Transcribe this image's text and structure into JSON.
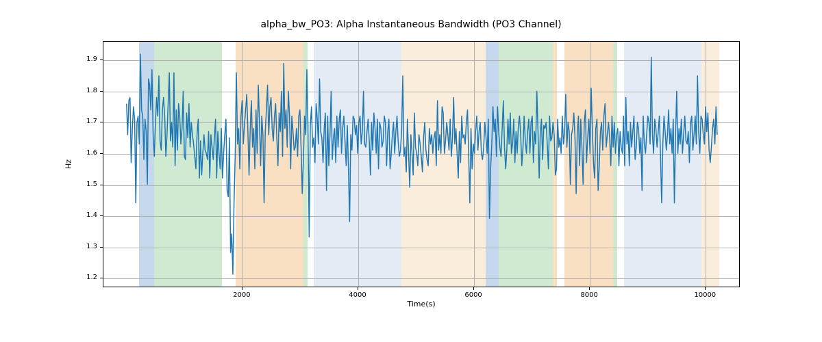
{
  "chart_data": {
    "type": "line",
    "title": "alpha_bw_PO3: Alpha Instantaneous Bandwidth (PO3 Channel)",
    "xlabel": "Time(s)",
    "ylabel": "Hz",
    "xlim": [
      -400,
      10600
    ],
    "ylim": [
      1.17,
      1.96
    ],
    "xticks": [
      2000,
      4000,
      6000,
      8000,
      10000
    ],
    "yticks": [
      1.2,
      1.3,
      1.4,
      1.5,
      1.6,
      1.7,
      1.8,
      1.9
    ],
    "grid": true,
    "line_color": "#1f77b4",
    "bands": [
      {
        "x0": 220,
        "x1": 480,
        "color": "#c3d7eb"
      },
      {
        "x0": 480,
        "x1": 1650,
        "color": "#cde8cf"
      },
      {
        "x0": 1880,
        "x1": 3050,
        "color": "#f9dec0"
      },
      {
        "x0": 3050,
        "x1": 3120,
        "color": "#cde8cf"
      },
      {
        "x0": 3230,
        "x1": 4750,
        "color": "#e2eaf4"
      },
      {
        "x0": 4750,
        "x1": 6200,
        "color": "#fbecd9"
      },
      {
        "x0": 6200,
        "x1": 6420,
        "color": "#c3d7eb"
      },
      {
        "x0": 6420,
        "x1": 7360,
        "color": "#cde8cf"
      },
      {
        "x0": 7360,
        "x1": 7430,
        "color": "#f9dec0"
      },
      {
        "x0": 7560,
        "x1": 8400,
        "color": "#f9dec0"
      },
      {
        "x0": 8400,
        "x1": 8470,
        "color": "#cde8cf"
      },
      {
        "x0": 8590,
        "x1": 9930,
        "color": "#e2eaf4"
      },
      {
        "x0": 9930,
        "x1": 10230,
        "color": "#fbecd9"
      }
    ],
    "x": [
      0,
      20,
      40,
      60,
      80,
      100,
      120,
      140,
      160,
      180,
      200,
      220,
      240,
      260,
      280,
      300,
      320,
      340,
      360,
      380,
      400,
      420,
      440,
      460,
      480,
      500,
      520,
      540,
      560,
      580,
      600,
      620,
      640,
      660,
      680,
      700,
      720,
      740,
      760,
      780,
      800,
      820,
      840,
      860,
      880,
      900,
      920,
      940,
      960,
      980,
      1000,
      1020,
      1040,
      1060,
      1080,
      1100,
      1120,
      1140,
      1160,
      1180,
      1200,
      1220,
      1240,
      1260,
      1280,
      1300,
      1320,
      1340,
      1360,
      1380,
      1400,
      1420,
      1440,
      1460,
      1480,
      1500,
      1520,
      1540,
      1560,
      1580,
      1600,
      1620,
      1640,
      1660,
      1680,
      1700,
      1720,
      1740,
      1760,
      1780,
      1800,
      1820,
      1840,
      1860,
      1880,
      1900,
      1920,
      1940,
      1960,
      1980,
      2000,
      2020,
      2040,
      2060,
      2080,
      2100,
      2120,
      2140,
      2160,
      2180,
      2200,
      2220,
      2240,
      2260,
      2280,
      2300,
      2320,
      2340,
      2360,
      2380,
      2400,
      2420,
      2440,
      2460,
      2480,
      2500,
      2520,
      2540,
      2560,
      2580,
      2600,
      2620,
      2640,
      2660,
      2680,
      2700,
      2720,
      2740,
      2760,
      2780,
      2800,
      2820,
      2840,
      2860,
      2880,
      2900,
      2920,
      2940,
      2960,
      2980,
      3000,
      3020,
      3040,
      3060,
      3080,
      3100,
      3120,
      3140,
      3160,
      3180,
      3200,
      3220,
      3240,
      3260,
      3280,
      3300,
      3320,
      3340,
      3360,
      3380,
      3400,
      3420,
      3440,
      3460,
      3480,
      3500,
      3520,
      3540,
      3560,
      3580,
      3600,
      3620,
      3640,
      3660,
      3680,
      3700,
      3720,
      3740,
      3760,
      3780,
      3800,
      3820,
      3840,
      3860,
      3880,
      3900,
      3920,
      3940,
      3960,
      3980,
      4000,
      4020,
      4040,
      4060,
      4080,
      4100,
      4120,
      4140,
      4160,
      4180,
      4200,
      4220,
      4240,
      4260,
      4280,
      4300,
      4320,
      4340,
      4360,
      4380,
      4400,
      4420,
      4440,
      4460,
      4480,
      4500,
      4520,
      4540,
      4560,
      4580,
      4600,
      4620,
      4640,
      4660,
      4680,
      4700,
      4720,
      4740,
      4760,
      4780,
      4800,
      4820,
      4840,
      4860,
      4880,
      4900,
      4920,
      4940,
      4960,
      4980,
      5000,
      5020,
      5040,
      5060,
      5080,
      5100,
      5120,
      5140,
      5160,
      5180,
      5200,
      5220,
      5240,
      5260,
      5280,
      5300,
      5320,
      5340,
      5360,
      5380,
      5400,
      5420,
      5440,
      5460,
      5480,
      5500,
      5520,
      5540,
      5560,
      5580,
      5600,
      5620,
      5640,
      5660,
      5680,
      5700,
      5720,
      5740,
      5760,
      5780,
      5800,
      5820,
      5840,
      5860,
      5880,
      5900,
      5920,
      5940,
      5960,
      5980,
      6000,
      6020,
      6040,
      6060,
      6080,
      6100,
      6120,
      6140,
      6160,
      6180,
      6200,
      6220,
      6240,
      6260,
      6280,
      6300,
      6320,
      6340,
      6360,
      6380,
      6400,
      6420,
      6440,
      6460,
      6480,
      6500,
      6520,
      6540,
      6560,
      6580,
      6600,
      6620,
      6640,
      6660,
      6680,
      6700,
      6720,
      6740,
      6760,
      6780,
      6800,
      6820,
      6840,
      6860,
      6880,
      6900,
      6920,
      6940,
      6960,
      6980,
      7000,
      7020,
      7040,
      7060,
      7080,
      7100,
      7120,
      7140,
      7160,
      7180,
      7200,
      7220,
      7240,
      7260,
      7280,
      7300,
      7320,
      7340,
      7360,
      7380,
      7400,
      7420,
      7440,
      7460,
      7480,
      7500,
      7520,
      7540,
      7560,
      7580,
      7600,
      7620,
      7640,
      7660,
      7680,
      7700,
      7720,
      7740,
      7760,
      7780,
      7800,
      7820,
      7840,
      7860,
      7880,
      7900,
      7920,
      7940,
      7960,
      7980,
      8000,
      8020,
      8040,
      8060,
      8080,
      8100,
      8120,
      8140,
      8160,
      8180,
      8200,
      8220,
      8240,
      8260,
      8280,
      8300,
      8320,
      8340,
      8360,
      8380,
      8400,
      8420,
      8440,
      8460,
      8480,
      8500,
      8520,
      8540,
      8560,
      8580,
      8600,
      8620,
      8640,
      8660,
      8680,
      8700,
      8720,
      8740,
      8760,
      8780,
      8800,
      8820,
      8840,
      8860,
      8880,
      8900,
      8920,
      8940,
      8960,
      8980,
      9000,
      9020,
      9040,
      9060,
      9080,
      9100,
      9120,
      9140,
      9160,
      9180,
      9200,
      9220,
      9240,
      9260,
      9280,
      9300,
      9320,
      9340,
      9360,
      9380,
      9400,
      9420,
      9440,
      9460,
      9480,
      9500,
      9520,
      9540,
      9560,
      9580,
      9600,
      9620,
      9640,
      9660,
      9680,
      9700,
      9720,
      9740,
      9760,
      9780,
      9800,
      9820,
      9840,
      9860,
      9880,
      9900,
      9920,
      9940,
      9960,
      9980,
      10000,
      10020,
      10040,
      10060,
      10080,
      10100,
      10120,
      10140,
      10160,
      10180,
      10200,
      10220
    ],
    "y": [
      1.76,
      1.66,
      1.77,
      1.78,
      1.57,
      1.68,
      1.75,
      1.71,
      1.44,
      1.7,
      1.72,
      1.63,
      1.92,
      1.74,
      1.72,
      1.58,
      1.71,
      1.67,
      1.5,
      1.84,
      1.82,
      1.74,
      1.87,
      1.66,
      1.59,
      1.7,
      1.78,
      1.72,
      1.85,
      1.64,
      1.61,
      1.74,
      1.78,
      1.72,
      1.59,
      1.66,
      1.76,
      1.86,
      1.64,
      1.7,
      1.62,
      1.86,
      1.56,
      1.74,
      1.61,
      1.76,
      1.72,
      1.63,
      1.68,
      1.8,
      1.59,
      1.58,
      1.73,
      1.65,
      1.76,
      1.62,
      1.7,
      1.66,
      1.63,
      1.59,
      1.55,
      1.66,
      1.71,
      1.52,
      1.64,
      1.53,
      1.6,
      1.66,
      1.61,
      1.6,
      1.58,
      1.67,
      1.52,
      1.66,
      1.62,
      1.58,
      1.65,
      1.71,
      1.52,
      1.67,
      1.6,
      1.55,
      1.68,
      1.52,
      1.6,
      1.66,
      1.71,
      1.48,
      1.46,
      1.65,
      1.28,
      1.34,
      1.21,
      1.44,
      1.59,
      1.86,
      1.63,
      1.68,
      1.55,
      1.72,
      1.77,
      1.63,
      1.69,
      1.74,
      1.79,
      1.67,
      1.53,
      1.68,
      1.77,
      1.62,
      1.68,
      1.55,
      1.74,
      1.6,
      1.82,
      1.7,
      1.56,
      1.72,
      1.66,
      1.44,
      1.67,
      1.74,
      1.82,
      1.66,
      1.75,
      1.78,
      1.68,
      1.64,
      1.72,
      1.76,
      1.65,
      1.56,
      1.73,
      1.67,
      1.8,
      1.59,
      1.89,
      1.68,
      1.74,
      1.62,
      1.8,
      1.72,
      1.55,
      1.72,
      1.67,
      1.61,
      1.62,
      1.68,
      1.59,
      1.72,
      1.74,
      1.62,
      1.47,
      1.58,
      1.72,
      1.66,
      1.87,
      1.68,
      1.33,
      1.69,
      1.75,
      1.62,
      1.65,
      1.57,
      1.76,
      1.71,
      1.63,
      1.84,
      1.67,
      1.65,
      1.57,
      1.68,
      1.73,
      1.48,
      1.72,
      1.56,
      1.66,
      1.8,
      1.58,
      1.65,
      1.68,
      1.57,
      1.72,
      1.62,
      1.71,
      1.74,
      1.6,
      1.68,
      1.72,
      1.64,
      1.56,
      1.69,
      1.55,
      1.38,
      1.66,
      1.61,
      1.72,
      1.71,
      1.66,
      1.69,
      1.6,
      1.7,
      1.72,
      1.63,
      1.67,
      1.8,
      1.63,
      1.62,
      1.67,
      1.71,
      1.64,
      1.53,
      1.7,
      1.61,
      1.73,
      1.68,
      1.6,
      1.71,
      1.55,
      1.7,
      1.68,
      1.62,
      1.64,
      1.72,
      1.7,
      1.56,
      1.67,
      1.71,
      1.55,
      1.6,
      1.66,
      1.7,
      1.6,
      1.67,
      1.72,
      1.64,
      1.59,
      1.61,
      1.67,
      1.85,
      1.59,
      1.62,
      1.54,
      1.71,
      1.6,
      1.49,
      1.66,
      1.6,
      1.53,
      1.73,
      1.62,
      1.6,
      1.56,
      1.66,
      1.63,
      1.59,
      1.54,
      1.65,
      1.7,
      1.61,
      1.58,
      1.56,
      1.68,
      1.63,
      1.66,
      1.6,
      1.65,
      1.67,
      1.56,
      1.77,
      1.61,
      1.66,
      1.6,
      1.75,
      1.73,
      1.6,
      1.64,
      1.7,
      1.66,
      1.61,
      1.71,
      1.59,
      1.65,
      1.78,
      1.63,
      1.68,
      1.6,
      1.52,
      1.67,
      1.57,
      1.72,
      1.65,
      1.66,
      1.63,
      1.7,
      1.74,
      1.6,
      1.44,
      1.68,
      1.55,
      1.63,
      1.6,
      1.67,
      1.72,
      1.61,
      1.67,
      1.7,
      1.6,
      1.58,
      1.62,
      1.7,
      1.65,
      1.6,
      1.71,
      1.39,
      1.55,
      1.63,
      1.75,
      1.67,
      1.71,
      1.59,
      1.75,
      1.67,
      1.62,
      1.59,
      1.68,
      1.77,
      1.62,
      1.55,
      1.61,
      1.71,
      1.63,
      1.73,
      1.6,
      1.63,
      1.71,
      1.57,
      1.67,
      1.6,
      1.69,
      1.72,
      1.66,
      1.56,
      1.62,
      1.72,
      1.64,
      1.6,
      1.67,
      1.71,
      1.6,
      1.7,
      1.72,
      1.57,
      1.67,
      1.63,
      1.8,
      1.67,
      1.52,
      1.67,
      1.71,
      1.58,
      1.69,
      1.68,
      1.7,
      1.63,
      1.55,
      1.72,
      1.64,
      1.65,
      1.7,
      1.66,
      1.53,
      1.55,
      1.71,
      1.62,
      1.65,
      1.6,
      1.72,
      1.63,
      1.67,
      1.79,
      1.62,
      1.7,
      1.67,
      1.5,
      1.66,
      1.68,
      1.73,
      1.65,
      1.47,
      1.67,
      1.72,
      1.56,
      1.71,
      1.62,
      1.5,
      1.7,
      1.74,
      1.57,
      1.65,
      1.71,
      1.6,
      1.81,
      1.68,
      1.57,
      1.52,
      1.68,
      1.71,
      1.48,
      1.56,
      1.67,
      1.7,
      1.61,
      1.72,
      1.76,
      1.62,
      1.66,
      1.7,
      1.65,
      1.56,
      1.72,
      1.62,
      1.7,
      1.6,
      1.66,
      1.68,
      1.56,
      1.67,
      1.62,
      1.6,
      1.72,
      1.56,
      1.78,
      1.63,
      1.67,
      1.56,
      1.7,
      1.62,
      1.67,
      1.72,
      1.58,
      1.62,
      1.7,
      1.68,
      1.6,
      1.65,
      1.48,
      1.72,
      1.63,
      1.6,
      1.66,
      1.72,
      1.7,
      1.63,
      1.91,
      1.66,
      1.6,
      1.71,
      1.68,
      1.62,
      1.67,
      1.72,
      1.59,
      1.44,
      1.63,
      1.72,
      1.67,
      1.61,
      1.66,
      1.74,
      1.63,
      1.68,
      1.6,
      1.71,
      1.44,
      1.66,
      1.8,
      1.6,
      1.68,
      1.63,
      1.71,
      1.6,
      1.66,
      1.72,
      1.64,
      1.63,
      1.67,
      1.57,
      1.7,
      1.72,
      1.61,
      1.66,
      1.72,
      1.63,
      1.85,
      1.67,
      1.6,
      1.72,
      1.71,
      1.66,
      1.63,
      1.75,
      1.67,
      1.73,
      1.61,
      1.57,
      1.62,
      1.68,
      1.71,
      1.63,
      1.75,
      1.66
    ]
  }
}
